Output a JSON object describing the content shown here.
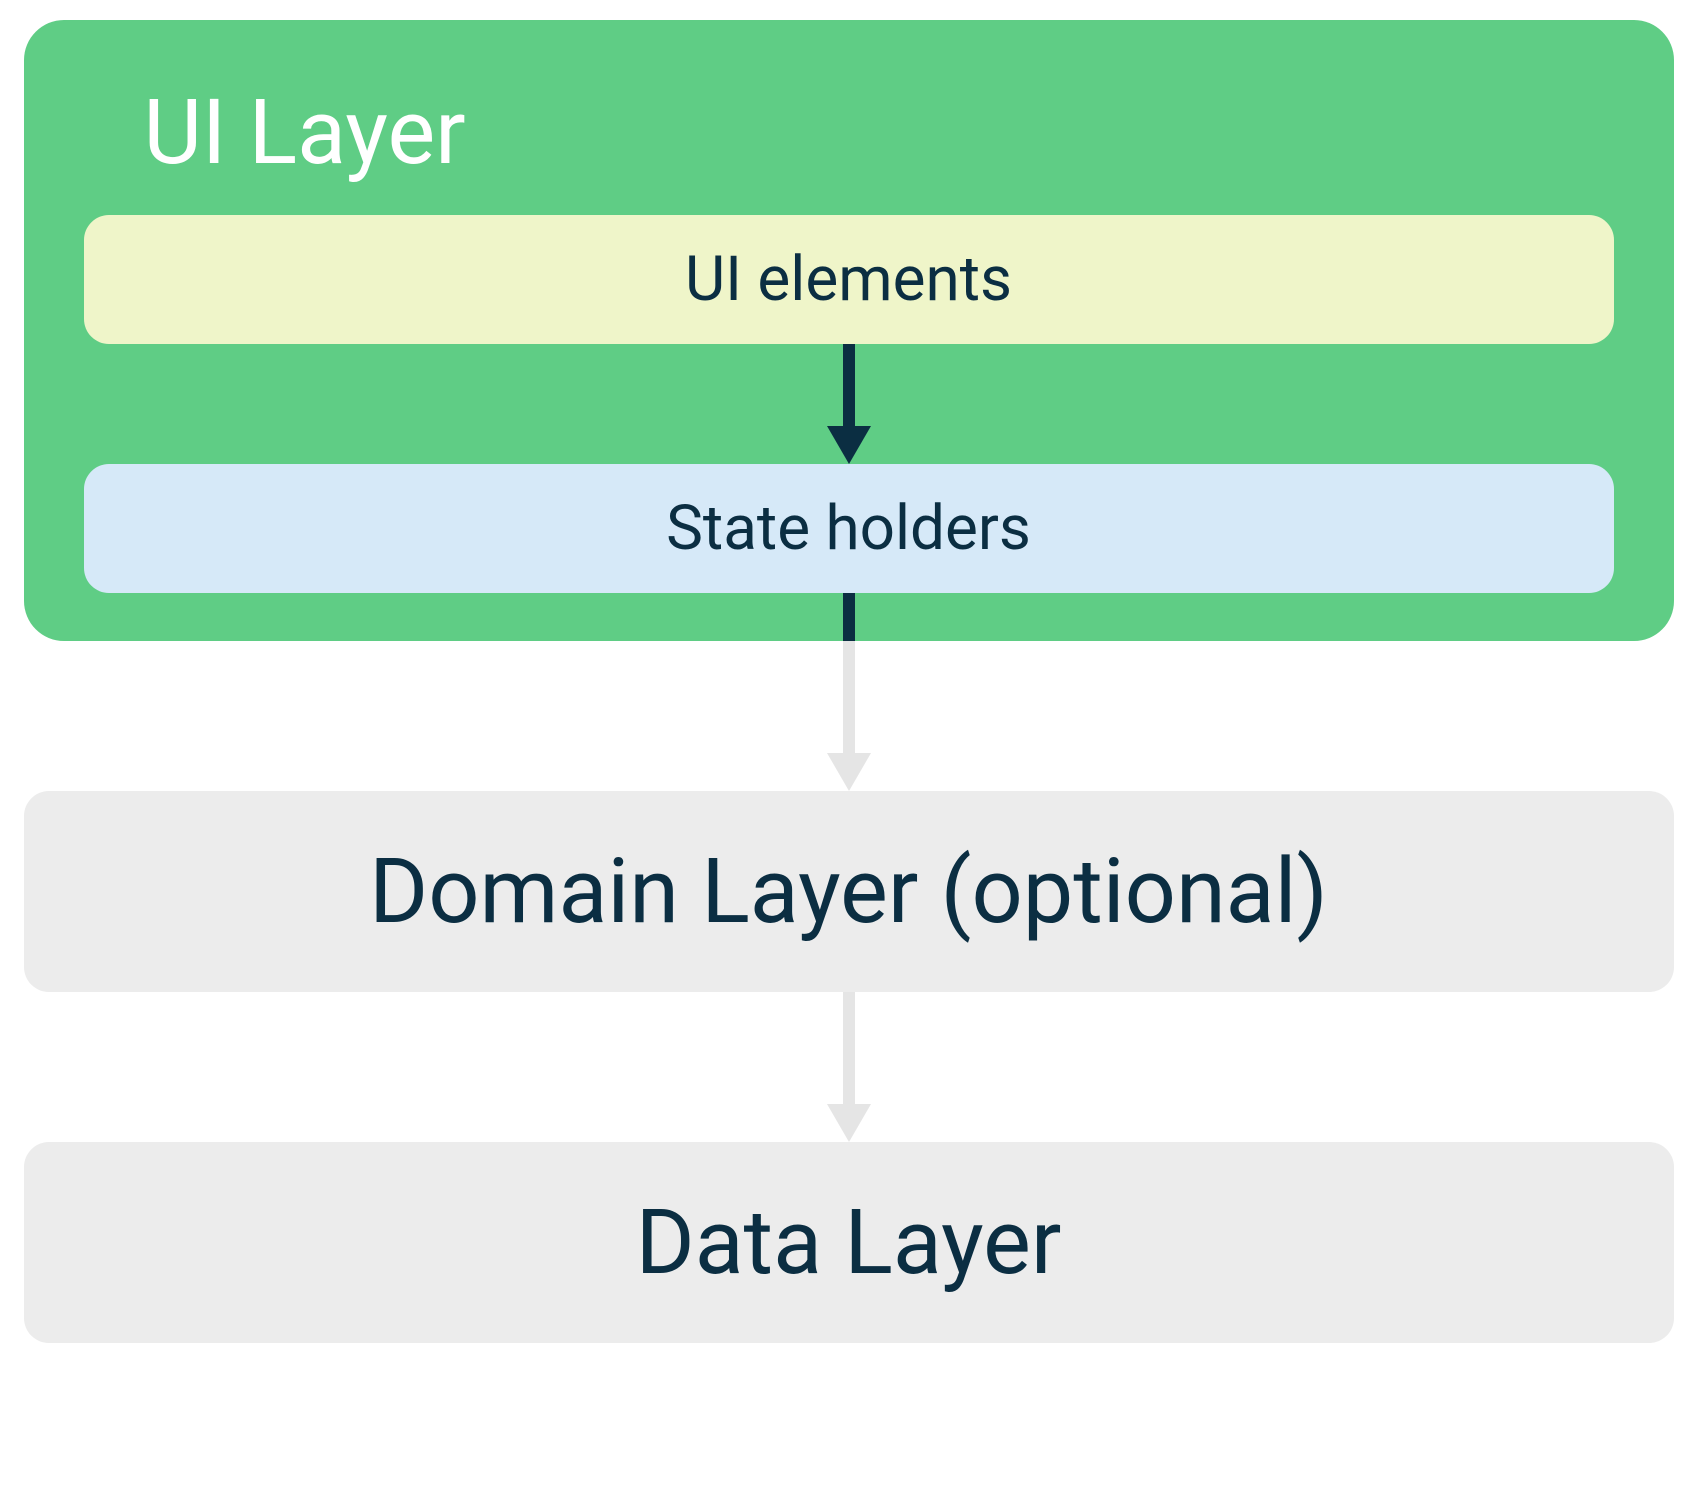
{
  "ui_layer": {
    "title": "UI Layer",
    "ui_elements_label": "UI elements",
    "state_holders_label": "State holders"
  },
  "domain_layer": {
    "label": "Domain Layer (optional)"
  },
  "data_layer": {
    "label": "Data Layer"
  },
  "colors": {
    "green": "#5fcd85",
    "cream": "#eff5c9",
    "lightblue": "#d6e9f8",
    "grey": "#ececec",
    "darktext": "#0b2e42",
    "arrowdark": "#0b2e42",
    "arrowlight": "#e5e5e5"
  }
}
